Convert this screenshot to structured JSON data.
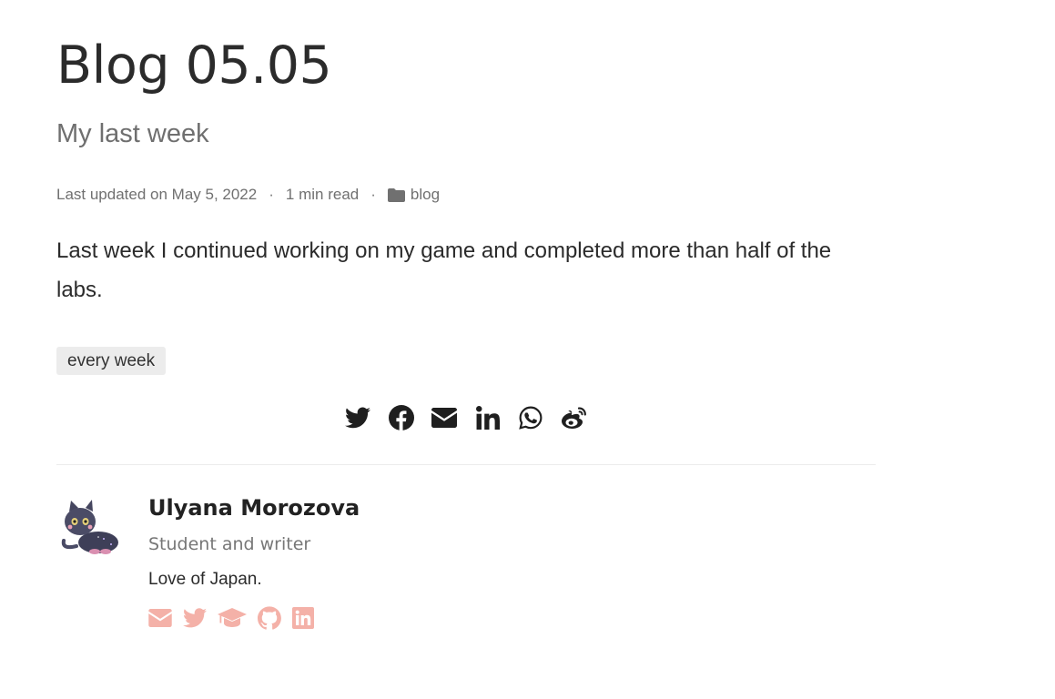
{
  "post": {
    "title": "Blog 05.05",
    "subtitle": "My last week",
    "updated": "Last updated on May 5, 2022",
    "separator": "·",
    "read_time": "1 min read",
    "category": "blog",
    "body": "Last week I continued working on my game and completed more than half of the labs.",
    "tags": [
      "every week"
    ]
  },
  "share": {
    "icon_color": "#1f1f1f",
    "icons": [
      "twitter-icon",
      "facebook-icon",
      "email-icon",
      "linkedin-icon",
      "whatsapp-icon",
      "weibo-icon"
    ]
  },
  "author": {
    "name": "Ulyana Morozova",
    "role": "Student and writer",
    "bio": "Love of Japan.",
    "link_color": "#f4b1a8",
    "links": [
      "email-icon",
      "twitter-icon",
      "graduation-cap-icon",
      "github-icon",
      "linkedin-icon"
    ]
  }
}
